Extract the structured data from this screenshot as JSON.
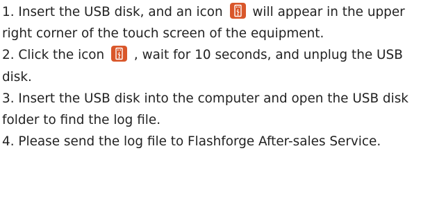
{
  "steps": [
    {
      "before": "1. Insert the USB disk, and an icon ",
      "icon": "usb-drive-icon",
      "after": " will appear in the upper right corner of the touch screen of the equipment."
    },
    {
      "before": "2. Click the icon ",
      "icon": "usb-drive-icon",
      "after": " , wait for 10 seconds, and unplug the USB disk."
    },
    {
      "text": "3. Insert the USB disk into the computer and open the USB disk folder to find the log file."
    },
    {
      "text": "4. Please send the log file to Flashforge After-sales Service."
    }
  ],
  "colors": {
    "icon_background": "#d9572b",
    "text": "#222222"
  }
}
